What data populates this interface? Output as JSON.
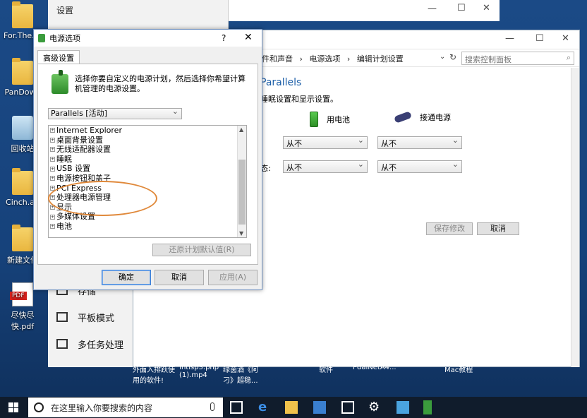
{
  "desktop": {
    "icons": [
      "For.The.Ki",
      "PanDown",
      "回收站",
      "Cinch.ap",
      "新建文件",
      "尽快尽快.pdf"
    ]
  },
  "settings_window": {
    "title": "设置",
    "items": [
      "存储",
      "平板模式",
      "多任务处理"
    ]
  },
  "control_panel": {
    "breadcrumbs": [
      "件和声音",
      "›",
      "电源选项",
      "›",
      "编辑计划设置"
    ],
    "search_placeholder": "搜索控制面板",
    "plan_title": "Parallels",
    "plan_desc": "睡眠设置和显示设置。",
    "col_battery": "用电池",
    "col_plugged": "接通电源",
    "row2_label": "态:",
    "val_never": "从不",
    "save_btn": "保存修改",
    "cancel_btn": "取消"
  },
  "power_dialog": {
    "title": "电源选项",
    "help": "?",
    "close": "✕",
    "tab": "高级设置",
    "instruction": "选择你要自定义的电源计划，然后选择你希望计算机管理的电源设置。",
    "plan_selected": "Parallels [活动]",
    "tree": [
      "Internet Explorer",
      "桌面背景设置",
      "无线适配器设置",
      "睡眠",
      "USB 设置",
      "电源按钮和盖子",
      "PCI Express",
      "处理器电源管理",
      "显示",
      "多媒体设置",
      "电池"
    ],
    "restore_btn": "还原计划默认值(R)",
    "ok_btn": "确定",
    "cancel_btn": "取消",
    "apply_btn": "应用(A)"
  },
  "taskbar": {
    "search_placeholder": "在这里输入你要搜索的内容",
    "task_labels": [
      "外面入排跃使\n用的软件!",
      "Intisp3.php\n(1).mp4",
      "绿茵酒《阿\n刁》超稳...",
      "软件",
      "PdalNetA4...",
      "Mac教程"
    ]
  }
}
